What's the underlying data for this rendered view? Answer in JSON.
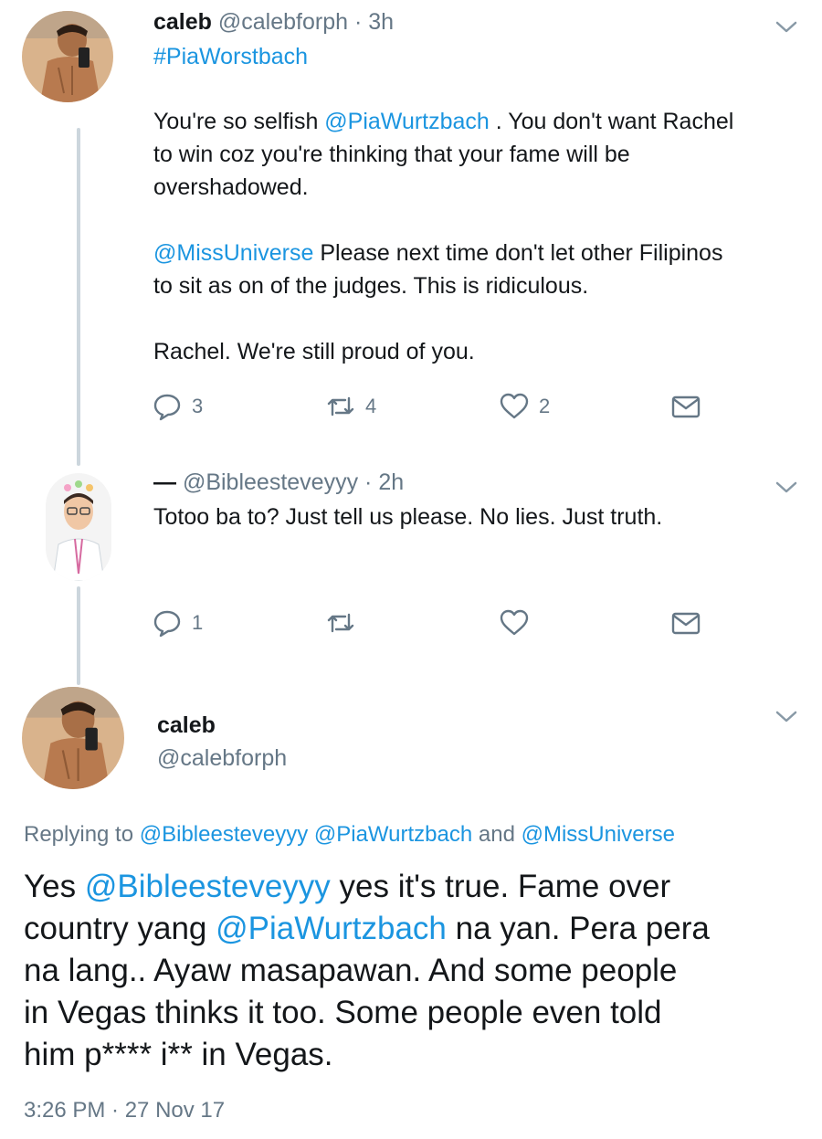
{
  "tweet1": {
    "display_name": "caleb",
    "handle": "@calebforph",
    "time": "· 3h",
    "hashtag": "#PiaWorstbach",
    "p1_a": "You're so selfish ",
    "p1_mention": "@PiaWurtzbach",
    "p1_b": " . You don't want Rachel",
    "p1_line2": "to win coz you're thinking that your fame will be",
    "p1_line3": "overshadowed.",
    "p2_mention": "@MissUniverse",
    "p2_a": "  Please next time don't let other Filipinos",
    "p2_line2": "to sit as on of the judges.  This is ridiculous.",
    "p3": "Rachel. We're still proud of you.",
    "replies": "3",
    "retweets": "4",
    "likes": "2"
  },
  "tweet2": {
    "display_name": "—",
    "handle": "@Bibleesteveyyy",
    "time": "· 2h",
    "text": "Totoo ba to? Just tell us please. No lies. Just truth.",
    "replies": "1"
  },
  "tweet3": {
    "display_name": "caleb",
    "handle": "@calebforph",
    "replying_prefix": "Replying to ",
    "replying_1": "@Bibleesteveyyy",
    "replying_2": "@PiaWurtzbach",
    "replying_and": " and ",
    "replying_3": "@MissUniverse",
    "l1_a": "Yes ",
    "l1_mention": "@Bibleesteveyyy",
    "l1_b": "  yes it's true. Fame over",
    "l2_a": "country yang ",
    "l2_mention": "@PiaWurtzbach",
    "l2_b": " na yan. Pera pera",
    "l3": "na lang.. Ayaw masapawan. And some people",
    "l4": "in Vegas thinks it too.  Some people even told",
    "l5": "him p**** i** in Vegas.",
    "timestamp": "3:26 PM · 27 Nov 17"
  },
  "colors": {
    "link": "#1b95e0",
    "muted": "#657786",
    "text": "#14171a",
    "thread_line": "#ccd6dd"
  },
  "icons": [
    "reply-icon",
    "retweet-icon",
    "like-icon",
    "share-dm-icon",
    "chevron-down-icon"
  ]
}
